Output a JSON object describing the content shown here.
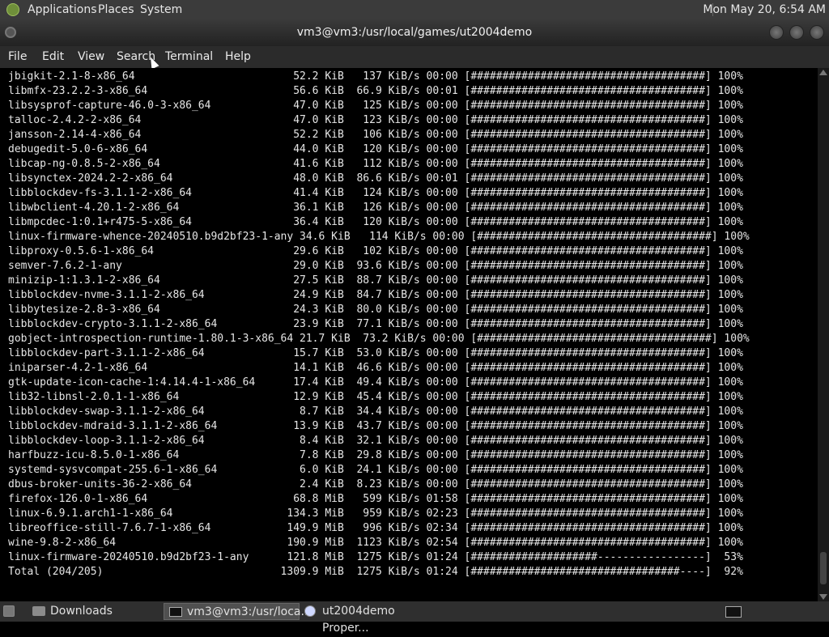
{
  "top_panel": {
    "menus": [
      "Applications",
      "Places",
      "System"
    ],
    "clock": "Mon May 20,  6:54 AM"
  },
  "window": {
    "title": "vm3@vm3:/usr/local/games/ut2004demo"
  },
  "menubar": [
    "File",
    "Edit",
    "View",
    "Search",
    "Terminal",
    "Help"
  ],
  "terminal": {
    "lines": [
      " jbigkit-2.1-8-x86_64                         52.2 KiB   137 KiB/s 00:00 [#####################################] 100%",
      " libmfx-23.2.2-3-x86_64                       56.6 KiB  66.9 KiB/s 00:01 [#####################################] 100%",
      " libsysprof-capture-46.0-3-x86_64             47.0 KiB   125 KiB/s 00:00 [#####################################] 100%",
      " talloc-2.4.2-2-x86_64                        47.0 KiB   123 KiB/s 00:00 [#####################################] 100%",
      " jansson-2.14-4-x86_64                        52.2 KiB   106 KiB/s 00:00 [#####################################] 100%",
      " debugedit-5.0-6-x86_64                       44.0 KiB   120 KiB/s 00:00 [#####################################] 100%",
      " libcap-ng-0.8.5-2-x86_64                     41.6 KiB   112 KiB/s 00:00 [#####################################] 100%",
      " libsynctex-2024.2-2-x86_64                   48.0 KiB  86.6 KiB/s 00:01 [#####################################] 100%",
      " libblockdev-fs-3.1.1-2-x86_64                41.4 KiB   124 KiB/s 00:00 [#####################################] 100%",
      " libwbclient-4.20.1-2-x86_64                  36.1 KiB   126 KiB/s 00:00 [#####################################] 100%",
      " libmpcdec-1:0.1+r475-5-x86_64                36.4 KiB   120 KiB/s 00:00 [#####################################] 100%",
      " linux-firmware-whence-20240510.b9d2bf23-1-any 34.6 KiB   114 KiB/s 00:00 [#####################################] 100%",
      " libproxy-0.5.6-1-x86_64                      29.6 KiB   102 KiB/s 00:00 [#####################################] 100%",
      " semver-7.6.2-1-any                           29.0 KiB  93.6 KiB/s 00:00 [#####################################] 100%",
      " minizip-1:1.3.1-2-x86_64                     27.5 KiB  88.7 KiB/s 00:00 [#####################################] 100%",
      " libblockdev-nvme-3.1.1-2-x86_64              24.9 KiB  84.7 KiB/s 00:00 [#####################################] 100%",
      " libbytesize-2.8-3-x86_64                     24.3 KiB  80.0 KiB/s 00:00 [#####################################] 100%",
      " libblockdev-crypto-3.1.1-2-x86_64            23.9 KiB  77.1 KiB/s 00:00 [#####################################] 100%",
      " gobject-introspection-runtime-1.80.1-3-x86_64 21.7 KiB  73.2 KiB/s 00:00 [#####################################] 100%",
      " libblockdev-part-3.1.1-2-x86_64              15.7 KiB  53.0 KiB/s 00:00 [#####################################] 100%",
      " iniparser-4.2-1-x86_64                       14.1 KiB  46.6 KiB/s 00:00 [#####################################] 100%",
      " gtk-update-icon-cache-1:4.14.4-1-x86_64      17.4 KiB  49.4 KiB/s 00:00 [#####################################] 100%",
      " lib32-libnsl-2.0.1-1-x86_64                  12.9 KiB  45.4 KiB/s 00:00 [#####################################] 100%",
      " libblockdev-swap-3.1.1-2-x86_64               8.7 KiB  34.4 KiB/s 00:00 [#####################################] 100%",
      " libblockdev-mdraid-3.1.1-2-x86_64            13.9 KiB  43.7 KiB/s 00:00 [#####################################] 100%",
      " libblockdev-loop-3.1.1-2-x86_64               8.4 KiB  32.1 KiB/s 00:00 [#####################################] 100%",
      " harfbuzz-icu-8.5.0-1-x86_64                   7.8 KiB  29.8 KiB/s 00:00 [#####################################] 100%",
      " systemd-sysvcompat-255.6-1-x86_64             6.0 KiB  24.1 KiB/s 00:00 [#####################################] 100%",
      " dbus-broker-units-36-2-x86_64                 2.4 KiB  8.23 KiB/s 00:00 [#####################################] 100%",
      " firefox-126.0-1-x86_64                       68.8 MiB   599 KiB/s 01:58 [#####################################] 100%",
      " linux-6.9.1.arch1-1-x86_64                  134.3 MiB   959 KiB/s 02:23 [#####################################] 100%",
      " libreoffice-still-7.6.7-1-x86_64            149.9 MiB   996 KiB/s 02:34 [#####################################] 100%",
      " wine-9.8-2-x86_64                           190.9 MiB  1123 KiB/s 02:54 [#####################################] 100%",
      " linux-firmware-20240510.b9d2bf23-1-any      121.8 MiB  1275 KiB/s 01:24 [####################-----------------]  53%",
      " Total (204/205)                            1309.9 MiB  1275 KiB/s 01:24 [#################################----]  92%"
    ]
  },
  "taskbar": {
    "items": [
      {
        "label": "Downloads",
        "icon": "folder-icon"
      },
      {
        "label": "vm3@vm3:/usr/loca...",
        "icon": "terminal-icon"
      },
      {
        "label": "ut2004demo Proper...",
        "icon": "disc-icon"
      }
    ]
  },
  "colors": {
    "terminal_bg": "#000000",
    "terminal_fg": "#e6e6e6",
    "panel": "#3b3b3b"
  }
}
